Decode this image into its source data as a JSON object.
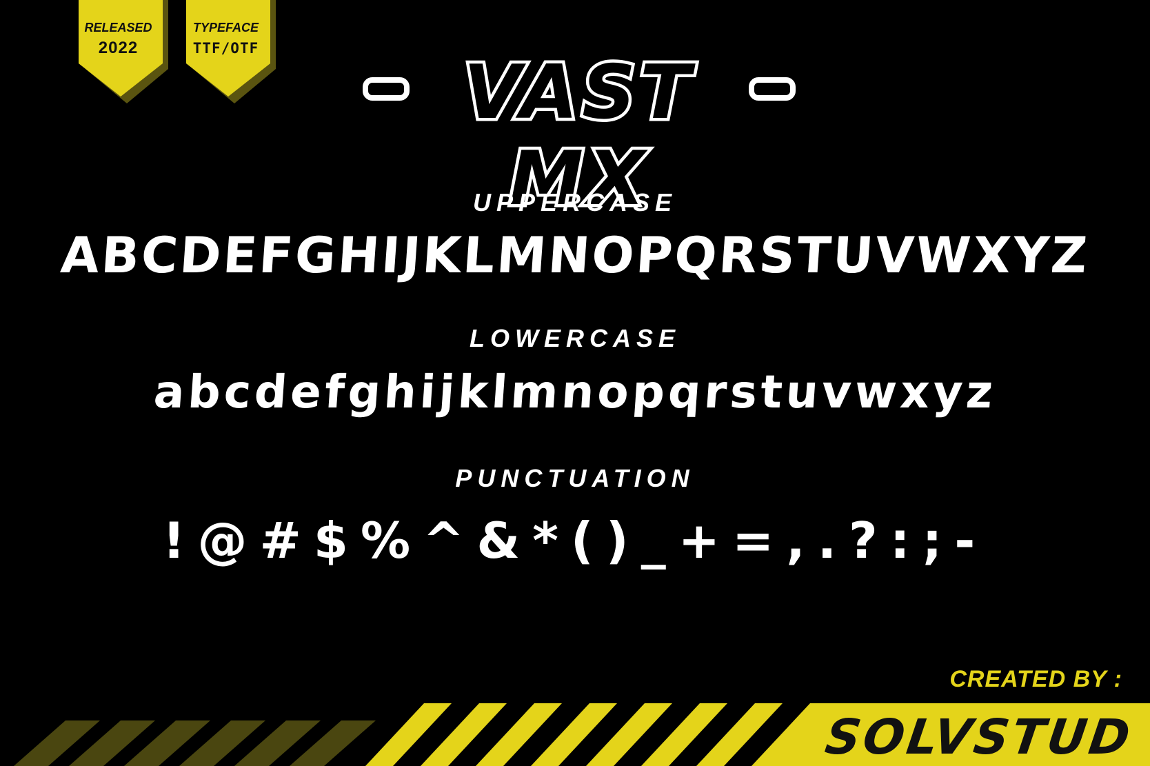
{
  "badges": {
    "released": {
      "line1": "RELEASED",
      "line2": "2022"
    },
    "typeface": {
      "line1": "TYPEFACE",
      "line2": "TTF/OTF"
    }
  },
  "title": {
    "text": "VAST MX"
  },
  "sections": {
    "uppercase": {
      "label": "UPPERCASE",
      "glyphs": "ABCDEFGHIJKLMNOPQRSTUVWXYZ"
    },
    "lowercase": {
      "label": "LOWERCASE",
      "glyphs": "abcdefghijklmnopqrstuvwxyz"
    },
    "punctuation": {
      "label": "PUNCTUATION",
      "glyphs": "!@#$%^&*()_+=,.?:;-"
    }
  },
  "credit": {
    "label": "CREATED BY :",
    "name": "SOLVSTUD"
  },
  "colors": {
    "accent": "#e4d41a",
    "background": "#000000",
    "text": "#ffffff"
  }
}
